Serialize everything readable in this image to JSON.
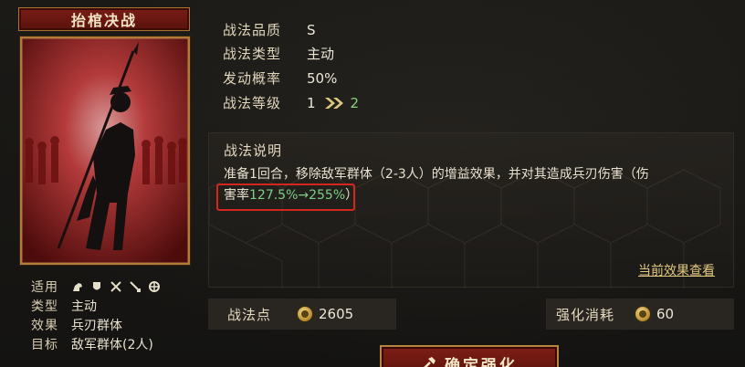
{
  "card": {
    "title": "抬棺决战",
    "attributes": {
      "suitable_label": "适用",
      "suitable_icons": [
        "cavalry-icon",
        "shield-icon",
        "crossed-swords-icon",
        "bow-icon",
        "war-machine-icon"
      ],
      "type_label": "类型",
      "type_value": "主动",
      "effect_label": "效果",
      "effect_value": "兵刃群体",
      "target_label": "目标",
      "target_value": "敌军群体(2人)"
    }
  },
  "info": {
    "quality_label": "战法品质",
    "quality_value": "S",
    "type_label": "战法类型",
    "type_value": "主动",
    "chance_label": "发动概率",
    "chance_value": "50%",
    "level_label": "战法等级",
    "level_current": "1",
    "level_next": "2"
  },
  "description": {
    "title": "战法说明",
    "text_line1": "准备1回合，移除敌军群体（2-3人）的增益效果，并对其造成兵刃伤害（伤",
    "text_line2_prefix": "害率",
    "text_line2_highlight": "127.5%→255%",
    "text_line2_suffix": "）",
    "effect_link": "当前效果查看"
  },
  "stats": {
    "points_label": "战法点",
    "points_value": "2605",
    "cost_label": "强化消耗",
    "cost_value": "60"
  },
  "confirm_button": "确定强化",
  "colors": {
    "accent_red": "#7a1c15",
    "gold_border": "#b07c38",
    "highlight_green": "#7ccf86",
    "annotation_red": "#d4261d"
  }
}
